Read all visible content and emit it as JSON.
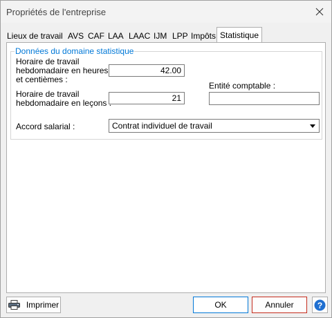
{
  "window": {
    "title": "Propriétés de l'entreprise"
  },
  "tabs": [
    "Lieux de travail",
    "AVS",
    "CAF",
    "LAA",
    "LAAC",
    "IJM",
    "LPP",
    "Impôts",
    "Statistique"
  ],
  "active_tab": "Statistique",
  "group": {
    "title": "Données du domaine statistique",
    "weekly_hours": {
      "label_line1": "Horaire de travail",
      "label_line2": "hebdomadaire en heures",
      "label_line3": "et centièmes :",
      "value": "42.00"
    },
    "weekly_lessons": {
      "label_line1": "Horaire de travail",
      "label_line2": "hebdomadaire en leçons :",
      "value": "21"
    },
    "accounting_entity": {
      "label": "Entité comptable :",
      "value": ""
    },
    "salary_agreement": {
      "label": "Accord salarial :",
      "value": "Contrat individuel de travail"
    }
  },
  "footer": {
    "print_label": "Imprimer",
    "ok_label": "OK",
    "cancel_label": "Annuler",
    "help_label": "?"
  },
  "colors": {
    "accent": "#0078d7",
    "cancel_border": "#c42b1c",
    "help_icon": "#1f6fd1"
  }
}
